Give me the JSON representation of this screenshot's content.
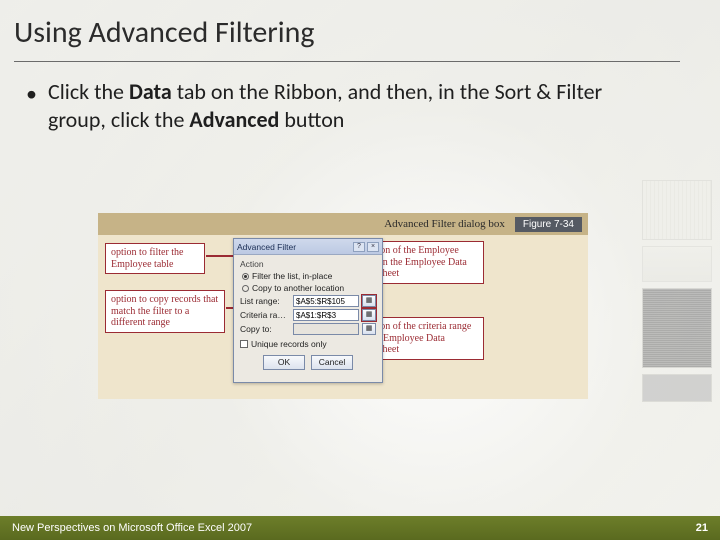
{
  "title": "Using Advanced Filtering",
  "bullet": {
    "pre": "Click the ",
    "b1": "Data",
    "mid": " tab on the Ribbon, and then, in the Sort & Filter group, click the ",
    "b2": "Advanced",
    "post": " button"
  },
  "figure": {
    "caption": "Advanced Filter dialog box",
    "figlabel": "Figure 7-34",
    "callouts": {
      "c1": "option to filter the Employee table",
      "c2": "option to copy records that match the filter to a different range",
      "c3": "location of the Employee table in the Employee Data worksheet",
      "c4": "location of the criteria range in the Employee Data worksheet"
    },
    "dialog": {
      "title": "Advanced Filter",
      "section": "Action",
      "radio1": "Filter the list, in-place",
      "radio2": "Copy to another location",
      "listLabel": "List range:",
      "listValue": "$A$5:$R$105",
      "critLabel": "Criteria range:",
      "critValue": "$A$1:$R$3",
      "copyLabel": "Copy to:",
      "copyValue": "",
      "uniqueLabel": "Unique records only",
      "ok": "OK",
      "cancel": "Cancel"
    }
  },
  "footer": {
    "left": "New Perspectives on Microsoft Office Excel 2007",
    "page": "21"
  }
}
